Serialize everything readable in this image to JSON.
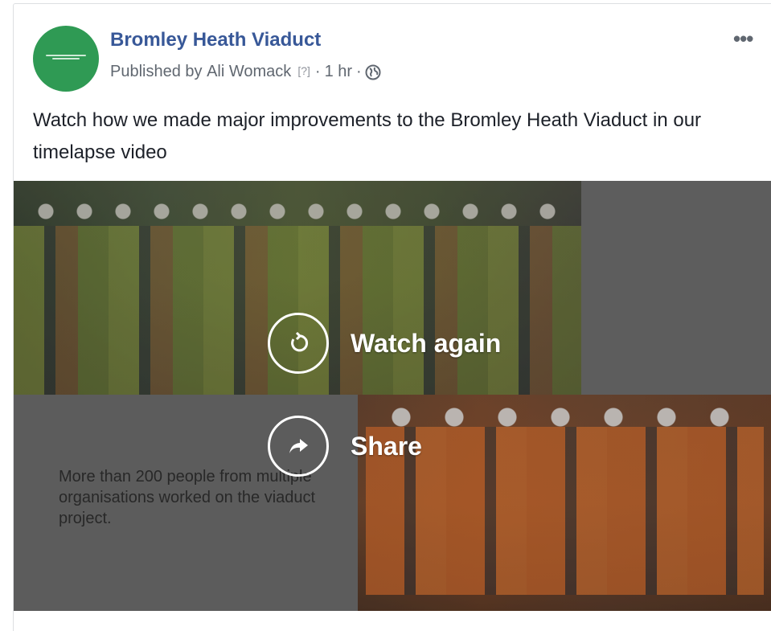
{
  "post": {
    "page_name": "Bromley Heath Viaduct",
    "published_prefix": "Published by",
    "author": "Ali Womack",
    "author_info": "[?]",
    "time": "1 hr",
    "separator": "·",
    "privacy_icon": "globe-icon",
    "more_icon": "more-options-icon",
    "more_label": "•••",
    "message": "Watch how we made major improvements to the Bromley Heath Viaduct in our timelapse video"
  },
  "video": {
    "caption": "More than 200 people from multiple organisations worked on the viaduct project.",
    "actions": [
      {
        "label": "Watch again",
        "icon": "replay-icon"
      },
      {
        "label": "Share",
        "icon": "share-arrow-icon"
      }
    ]
  },
  "colors": {
    "page_name": "#385898",
    "avatar_bg": "#2f9a54",
    "meta_text": "#606770"
  }
}
